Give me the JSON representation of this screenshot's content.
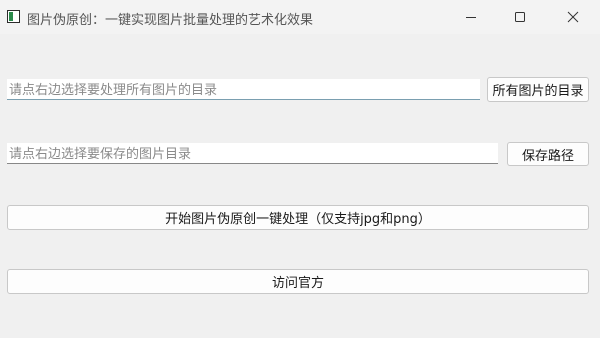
{
  "window": {
    "title": "图片伪原创：一键实现图片批量处理的艺术化效果",
    "controls": {
      "minimize_icon": "minimize-icon",
      "maximize_icon": "maximize-icon",
      "close_icon": "close-icon"
    }
  },
  "source": {
    "placeholder": "请点右边选择要处理所有图片的目录",
    "value": "",
    "button_label": "所有图片的目录"
  },
  "destination": {
    "placeholder": "请点右边选择要保存的图片目录",
    "value": "",
    "button_label": "保存路径"
  },
  "actions": {
    "start_label": "开始图片伪原创一键处理（仅支持jpg和png）",
    "website_label": "访问官方"
  },
  "colors": {
    "background": "#f0f0f0",
    "field_underline_focus": "#7a9fb0",
    "icon_green": "#2a8a4a"
  }
}
